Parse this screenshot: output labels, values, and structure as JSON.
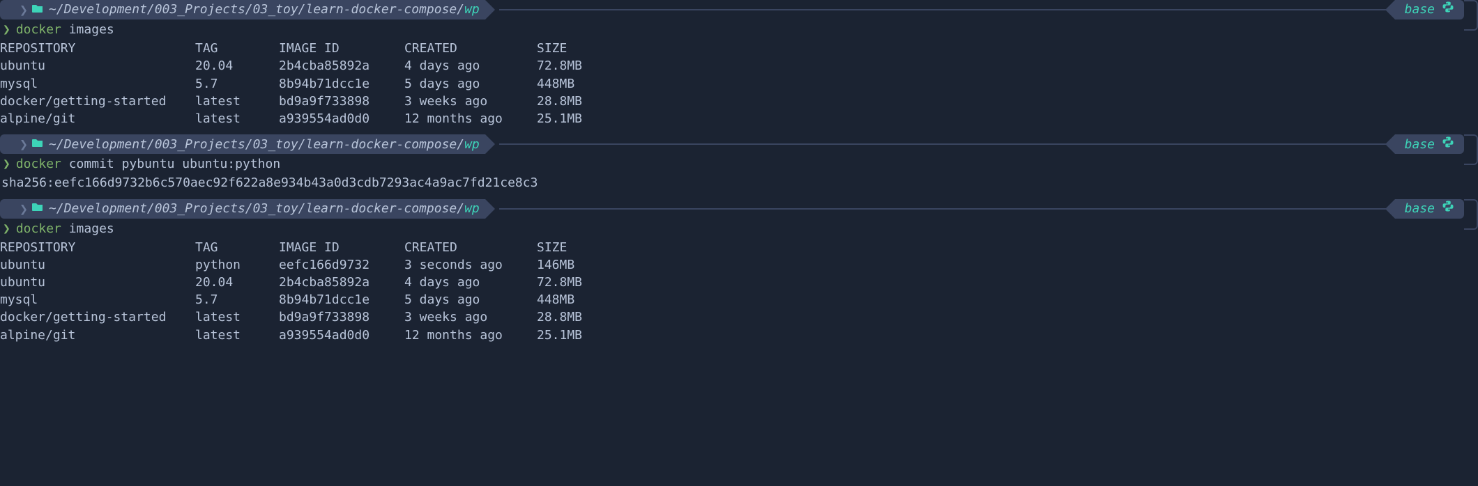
{
  "env_name": "base",
  "prompt": {
    "path_gray": "~/Development/003_Projects/03_toy/learn-docker-compose/",
    "path_teal": "wp"
  },
  "blocks": [
    {
      "command": {
        "exe": "docker",
        "args": "images"
      },
      "table": {
        "headers": [
          "REPOSITORY",
          "TAG",
          "IMAGE ID",
          "CREATED",
          "SIZE"
        ],
        "rows": [
          [
            "ubuntu",
            "20.04",
            "2b4cba85892a",
            "4 days ago",
            "72.8MB"
          ],
          [
            "mysql",
            "5.7",
            "8b94b71dcc1e",
            "5 days ago",
            "448MB"
          ],
          [
            "docker/getting-started",
            "latest",
            "bd9a9f733898",
            "3 weeks ago",
            "28.8MB"
          ],
          [
            "alpine/git",
            "latest",
            "a939554ad0d0",
            "12 months ago",
            "25.1MB"
          ]
        ]
      }
    },
    {
      "command": {
        "exe": "docker",
        "args": "commit pybuntu ubuntu:python"
      },
      "output": "sha256:eefc166d9732b6c570aec92f622a8e934b43a0d3cdb7293ac4a9ac7fd21ce8c3"
    },
    {
      "command": {
        "exe": "docker",
        "args": "images"
      },
      "table": {
        "headers": [
          "REPOSITORY",
          "TAG",
          "IMAGE ID",
          "CREATED",
          "SIZE"
        ],
        "rows": [
          [
            "ubuntu",
            "python",
            "eefc166d9732",
            "3 seconds ago",
            "146MB"
          ],
          [
            "ubuntu",
            "20.04",
            "2b4cba85892a",
            "4 days ago",
            "72.8MB"
          ],
          [
            "mysql",
            "5.7",
            "8b94b71dcc1e",
            "5 days ago",
            "448MB"
          ],
          [
            "docker/getting-started",
            "latest",
            "bd9a9f733898",
            "3 weeks ago",
            "28.8MB"
          ],
          [
            "alpine/git",
            "latest",
            "a939554ad0d0",
            "12 months ago",
            "25.1MB"
          ]
        ]
      }
    }
  ]
}
